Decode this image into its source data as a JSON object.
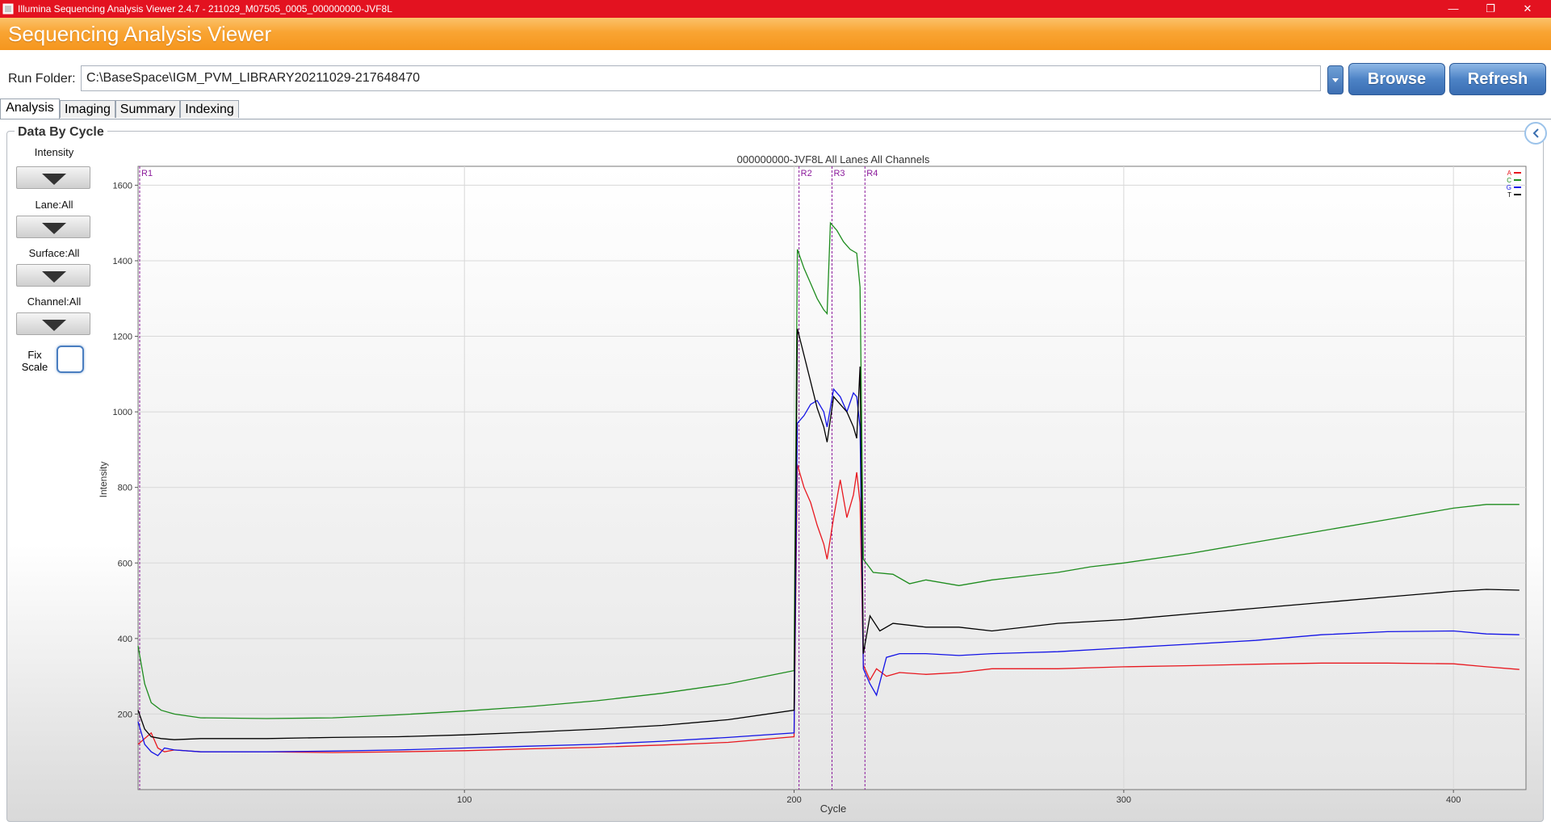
{
  "window": {
    "title": "Illumina Sequencing Analysis Viewer 2.4.7 - 211029_M07505_0005_000000000-JVF8L",
    "minimize_glyph": "—",
    "restore_glyph": "❐",
    "close_glyph": "✕"
  },
  "app": {
    "title": "Sequencing Analysis Viewer"
  },
  "run_folder": {
    "label": "Run Folder:",
    "value": "C:\\BaseSpace\\IGM_PVM_LIBRARY20211029-217648470",
    "browse_label": "Browse",
    "refresh_label": "Refresh"
  },
  "tabs": [
    {
      "label": "Analysis",
      "active": true
    },
    {
      "label": "Imaging",
      "active": false
    },
    {
      "label": "Summary",
      "active": false
    },
    {
      "label": "Indexing",
      "active": false
    }
  ],
  "panel": {
    "group_title": "Data By Cycle",
    "controls": [
      {
        "label": "Intensity"
      },
      {
        "label": "Lane:All"
      },
      {
        "label": "Surface:All"
      },
      {
        "label": "Channel:All"
      }
    ],
    "fix_scale_label": "Fix Scale",
    "fix_scale_checked": false
  },
  "colors": {
    "titlebar": "#e31220",
    "header": "#f7a329",
    "button": "#4d83c6",
    "read_marker": "#8b1a9b",
    "series_A": "#e8181f",
    "series_C": "#1e8c1e",
    "series_G": "#1414e6",
    "series_T": "#000000"
  },
  "chart_data": {
    "type": "line",
    "title": "000000000-JVF8L All Lanes All Channels",
    "xlabel": "Cycle",
    "ylabel": "Intensity",
    "xlim": [
      1,
      422
    ],
    "ylim": [
      0,
      1650
    ],
    "xticks": [
      100,
      200,
      300,
      400
    ],
    "yticks": [
      200,
      400,
      600,
      800,
      1000,
      1200,
      1400,
      1600
    ],
    "grid": true,
    "legend_position": "top-right",
    "read_markers": [
      {
        "label": "R1",
        "cycle": 1
      },
      {
        "label": "R2",
        "cycle": 201
      },
      {
        "label": "R3",
        "cycle": 211
      },
      {
        "label": "R4",
        "cycle": 221
      }
    ],
    "series": [
      {
        "name": "A",
        "color": "#e8181f",
        "points": [
          [
            1,
            120
          ],
          [
            3,
            135
          ],
          [
            5,
            150
          ],
          [
            7,
            110
          ],
          [
            9,
            100
          ],
          [
            12,
            105
          ],
          [
            20,
            100
          ],
          [
            40,
            100
          ],
          [
            60,
            98
          ],
          [
            80,
            100
          ],
          [
            100,
            103
          ],
          [
            120,
            108
          ],
          [
            140,
            112
          ],
          [
            160,
            118
          ],
          [
            180,
            125
          ],
          [
            200,
            140
          ],
          [
            201,
            860
          ],
          [
            203,
            800
          ],
          [
            205,
            760
          ],
          [
            207,
            700
          ],
          [
            209,
            650
          ],
          [
            210,
            610
          ],
          [
            212,
            720
          ],
          [
            214,
            820
          ],
          [
            216,
            720
          ],
          [
            218,
            780
          ],
          [
            219,
            840
          ],
          [
            220,
            760
          ],
          [
            221,
            330
          ],
          [
            223,
            290
          ],
          [
            225,
            320
          ],
          [
            228,
            300
          ],
          [
            232,
            310
          ],
          [
            240,
            305
          ],
          [
            250,
            310
          ],
          [
            260,
            320
          ],
          [
            280,
            320
          ],
          [
            300,
            325
          ],
          [
            320,
            328
          ],
          [
            340,
            332
          ],
          [
            360,
            335
          ],
          [
            380,
            335
          ],
          [
            400,
            333
          ],
          [
            410,
            325
          ],
          [
            420,
            318
          ]
        ]
      },
      {
        "name": "C",
        "color": "#1e8c1e",
        "points": [
          [
            1,
            380
          ],
          [
            3,
            280
          ],
          [
            5,
            230
          ],
          [
            8,
            210
          ],
          [
            12,
            200
          ],
          [
            20,
            190
          ],
          [
            40,
            188
          ],
          [
            60,
            190
          ],
          [
            80,
            198
          ],
          [
            100,
            208
          ],
          [
            120,
            220
          ],
          [
            140,
            235
          ],
          [
            160,
            255
          ],
          [
            180,
            280
          ],
          [
            200,
            315
          ],
          [
            201,
            1430
          ],
          [
            203,
            1380
          ],
          [
            205,
            1340
          ],
          [
            207,
            1300
          ],
          [
            209,
            1270
          ],
          [
            210,
            1260
          ],
          [
            211,
            1500
          ],
          [
            213,
            1480
          ],
          [
            215,
            1450
          ],
          [
            217,
            1430
          ],
          [
            219,
            1420
          ],
          [
            220,
            1330
          ],
          [
            221,
            610
          ],
          [
            224,
            575
          ],
          [
            230,
            570
          ],
          [
            235,
            545
          ],
          [
            240,
            555
          ],
          [
            250,
            540
          ],
          [
            260,
            555
          ],
          [
            270,
            565
          ],
          [
            280,
            575
          ],
          [
            290,
            590
          ],
          [
            300,
            600
          ],
          [
            320,
            625
          ],
          [
            340,
            655
          ],
          [
            360,
            685
          ],
          [
            380,
            715
          ],
          [
            400,
            745
          ],
          [
            410,
            755
          ],
          [
            420,
            755
          ]
        ]
      },
      {
        "name": "G",
        "color": "#1414e6",
        "points": [
          [
            1,
            180
          ],
          [
            3,
            120
          ],
          [
            5,
            100
          ],
          [
            7,
            90
          ],
          [
            9,
            110
          ],
          [
            12,
            105
          ],
          [
            20,
            100
          ],
          [
            40,
            100
          ],
          [
            60,
            102
          ],
          [
            80,
            105
          ],
          [
            100,
            110
          ],
          [
            120,
            115
          ],
          [
            140,
            120
          ],
          [
            160,
            128
          ],
          [
            180,
            138
          ],
          [
            200,
            150
          ],
          [
            201,
            970
          ],
          [
            203,
            990
          ],
          [
            205,
            1020
          ],
          [
            207,
            1030
          ],
          [
            209,
            1000
          ],
          [
            210,
            960
          ],
          [
            212,
            1060
          ],
          [
            214,
            1040
          ],
          [
            216,
            1000
          ],
          [
            218,
            1050
          ],
          [
            219,
            1040
          ],
          [
            220,
            960
          ],
          [
            221,
            320
          ],
          [
            223,
            280
          ],
          [
            225,
            250
          ],
          [
            228,
            350
          ],
          [
            232,
            360
          ],
          [
            240,
            360
          ],
          [
            250,
            355
          ],
          [
            260,
            360
          ],
          [
            280,
            365
          ],
          [
            300,
            375
          ],
          [
            320,
            385
          ],
          [
            340,
            395
          ],
          [
            360,
            410
          ],
          [
            380,
            418
          ],
          [
            400,
            420
          ],
          [
            410,
            412
          ],
          [
            420,
            410
          ]
        ]
      },
      {
        "name": "T",
        "color": "#000000",
        "points": [
          [
            1,
            210
          ],
          [
            3,
            160
          ],
          [
            5,
            140
          ],
          [
            8,
            135
          ],
          [
            12,
            132
          ],
          [
            20,
            135
          ],
          [
            40,
            135
          ],
          [
            60,
            138
          ],
          [
            80,
            140
          ],
          [
            100,
            145
          ],
          [
            120,
            152
          ],
          [
            140,
            160
          ],
          [
            160,
            170
          ],
          [
            180,
            185
          ],
          [
            200,
            210
          ],
          [
            201,
            1220
          ],
          [
            203,
            1150
          ],
          [
            205,
            1080
          ],
          [
            207,
            1010
          ],
          [
            209,
            960
          ],
          [
            210,
            920
          ],
          [
            212,
            1040
          ],
          [
            214,
            1020
          ],
          [
            216,
            1000
          ],
          [
            218,
            960
          ],
          [
            219,
            930
          ],
          [
            220,
            1120
          ],
          [
            221,
            360
          ],
          [
            223,
            460
          ],
          [
            226,
            420
          ],
          [
            230,
            440
          ],
          [
            240,
            430
          ],
          [
            250,
            430
          ],
          [
            260,
            420
          ],
          [
            280,
            440
          ],
          [
            300,
            450
          ],
          [
            320,
            465
          ],
          [
            340,
            480
          ],
          [
            360,
            495
          ],
          [
            380,
            510
          ],
          [
            400,
            525
          ],
          [
            410,
            530
          ],
          [
            420,
            528
          ]
        ]
      }
    ]
  }
}
